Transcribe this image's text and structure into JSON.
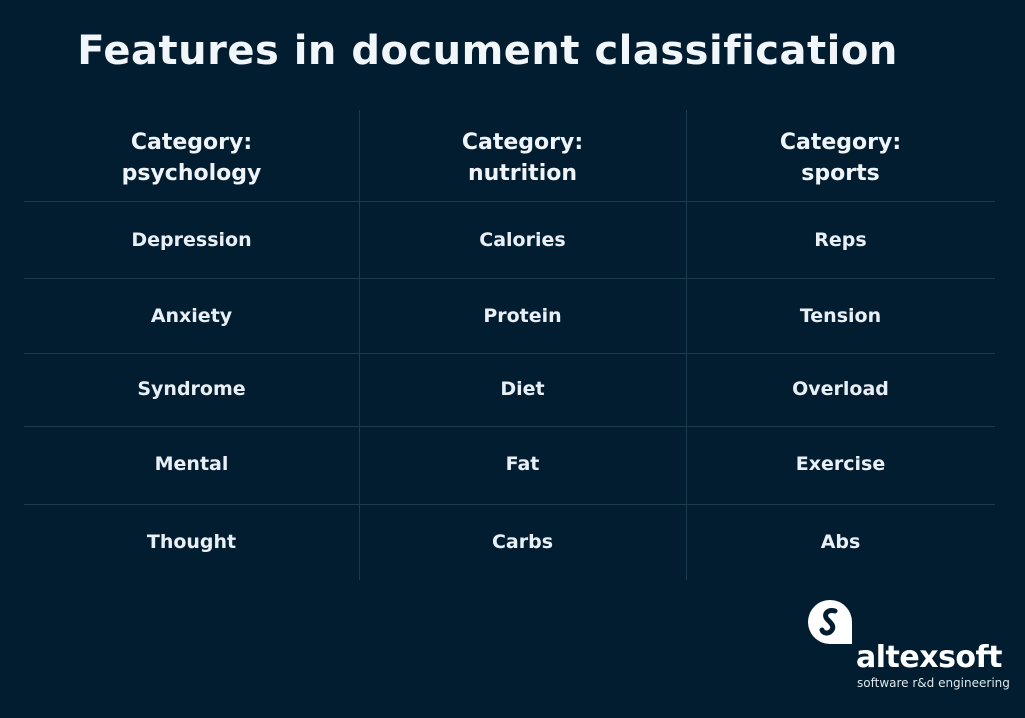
{
  "title": "Features in document classification",
  "table": {
    "headers": [
      {
        "line1": "Category:",
        "line2": "psychology"
      },
      {
        "line1": "Category:",
        "line2": "nutrition"
      },
      {
        "line1": "Category:",
        "line2": "sports"
      }
    ],
    "rows": [
      [
        "Depression",
        "Calories",
        "Reps"
      ],
      [
        "Anxiety",
        "Protein",
        "Tension"
      ],
      [
        "Syndrome",
        "Diet",
        "Overload"
      ],
      [
        "Mental",
        "Fat",
        "Exercise"
      ],
      [
        "Thought",
        "Carbs",
        "Abs"
      ]
    ]
  },
  "logo": {
    "icon": "altexsoft-logo-icon",
    "brand": "altexsoft",
    "tagline": "software r&d engineering"
  }
}
